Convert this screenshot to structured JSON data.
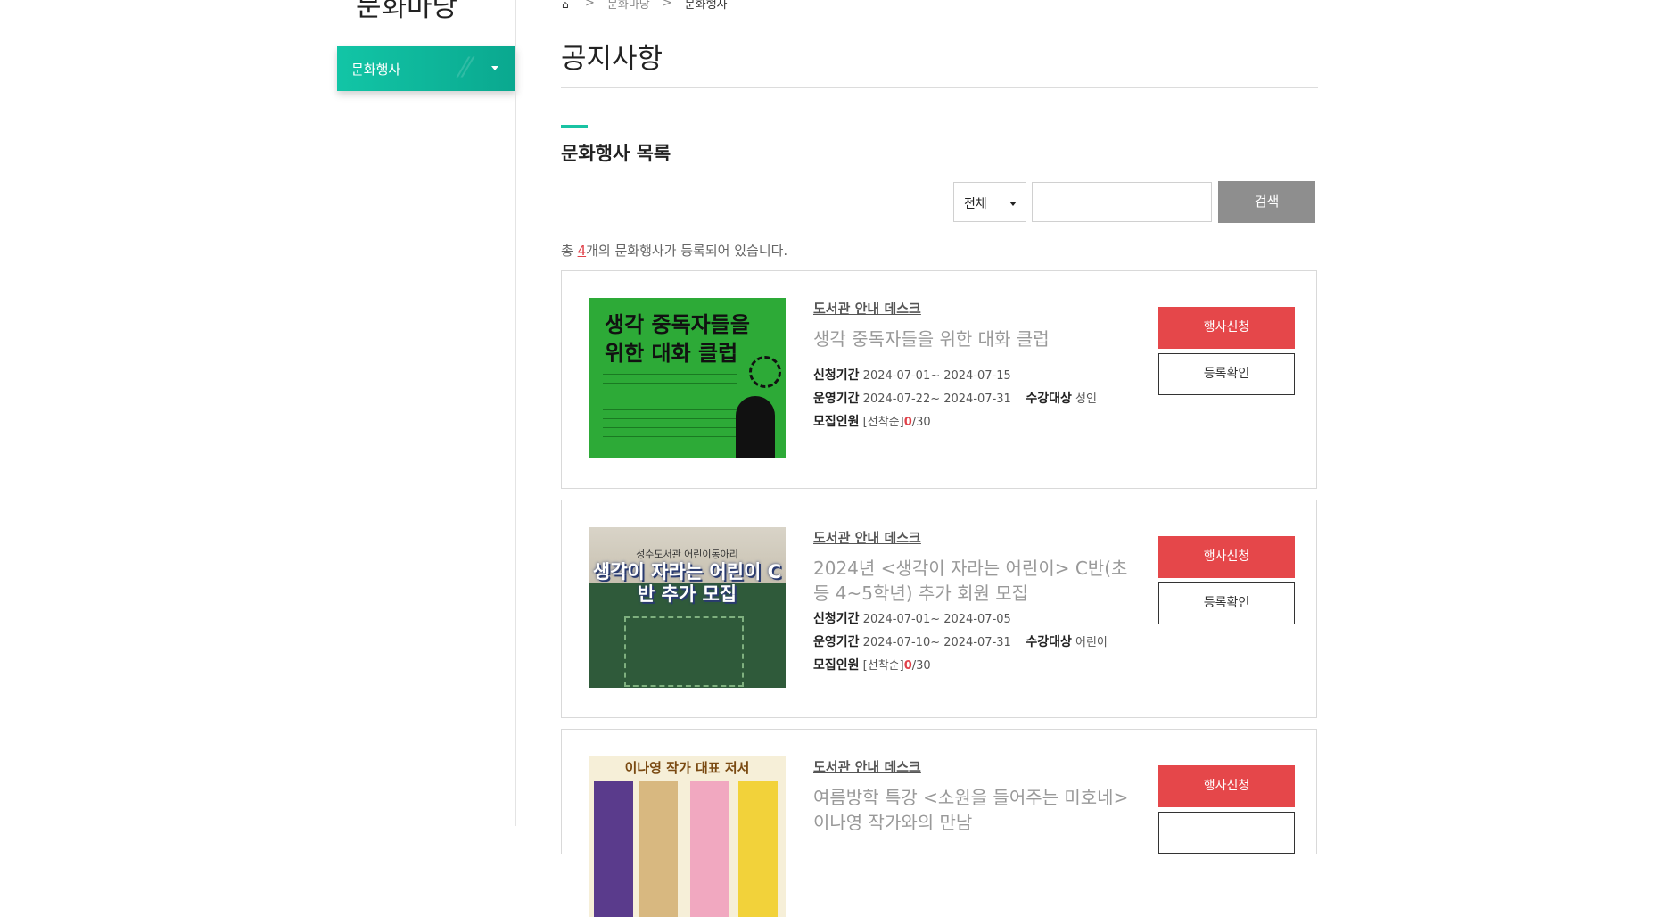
{
  "sidebar": {
    "title": "문화마당",
    "menu_label": "문화행사"
  },
  "breadcrumb": {
    "level1": "문화마당",
    "level2": "문화행사",
    "separator": ">"
  },
  "page_title": "공지사항",
  "section_title": "문화행사 목록",
  "search": {
    "select_value": "전체",
    "input_value": "",
    "button_label": "검색"
  },
  "count": {
    "prefix": "총 ",
    "number": "4",
    "suffix": "개의 문화행사가 등록되어 있습니다."
  },
  "labels": {
    "apply_period": "신청기간",
    "run_period": "운영기간",
    "target": "수강대상",
    "recruit": "모집인원",
    "apply_button": "행사신청",
    "check_button": "등록확인"
  },
  "events": [
    {
      "desk": "도서관 안내 데스크",
      "title": "생각 중독자들을 위한 대화 클럽",
      "apply_period": "2024-07-01~ 2024-07-15",
      "run_period": "2024-07-22~ 2024-07-31",
      "target": "성인",
      "recruit_type": "[선착순]",
      "recruit_current": "0",
      "recruit_total": "/30",
      "thumb_text": "생각 중독자들을 위한 대화 클럽"
    },
    {
      "desk": "도서관 안내 데스크",
      "title": "2024년 <생각이 자라는 어린이> C반(초등 4~5학년) 추가 회원 모집",
      "apply_period": "2024-07-01~ 2024-07-05",
      "run_period": "2024-07-10~ 2024-07-31",
      "target": "어린이",
      "recruit_type": "[선착순]",
      "recruit_current": "0",
      "recruit_total": "/30",
      "thumb_sub": "성수도서관 어린이동아리",
      "thumb_text": "생각이 자라는 어린이 C반 추가 모집"
    },
    {
      "desk": "도서관 안내 데스크",
      "title": "여름방학 특강 <소원을 들어주는 미호네> 이나영 작가와의 만남",
      "thumb_text": "이나영 작가 대표 저서"
    }
  ],
  "colors": {
    "accent": "#19c3a3",
    "apply_button": "#e5474a",
    "search_button": "#8e8e8e"
  }
}
